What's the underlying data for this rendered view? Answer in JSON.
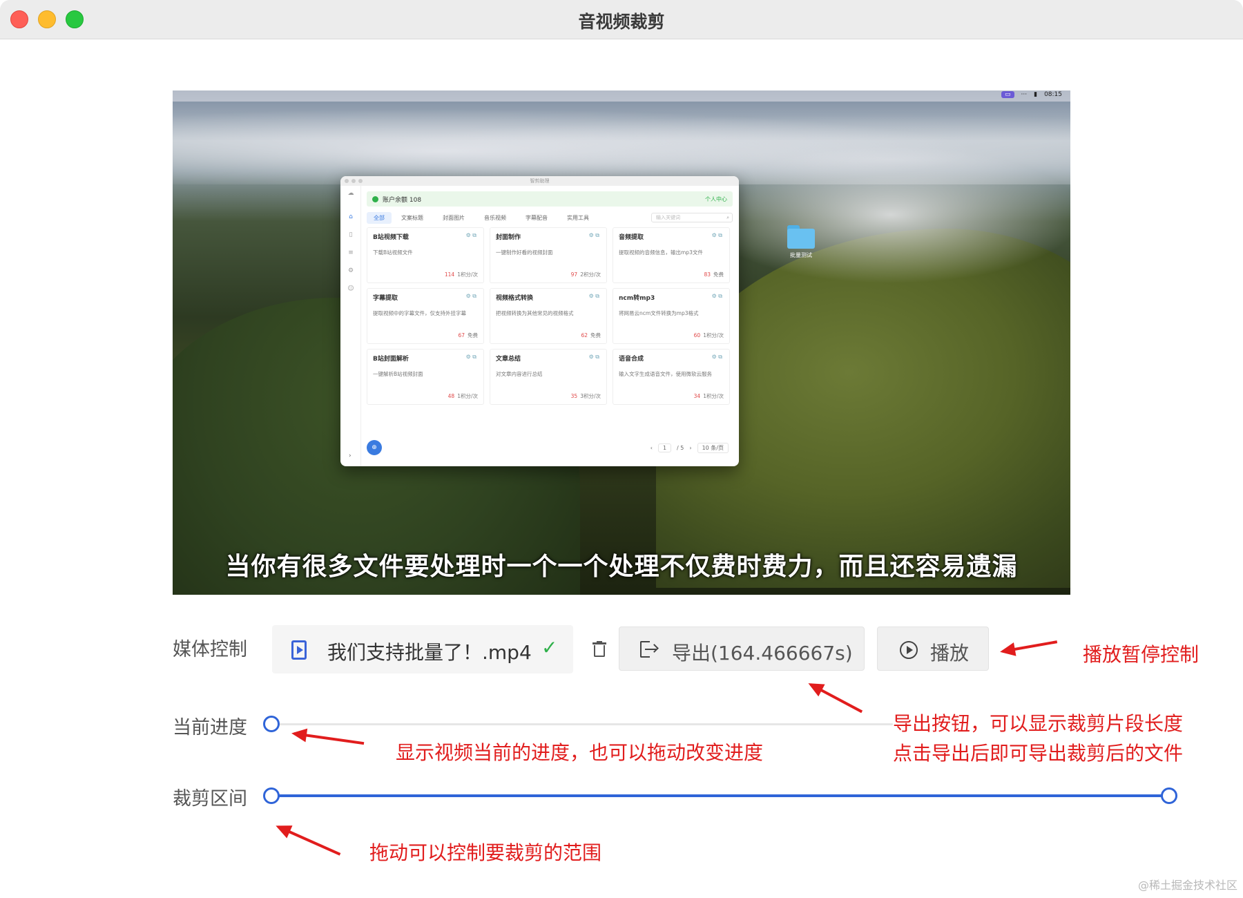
{
  "window": {
    "title": "音视频裁剪"
  },
  "video": {
    "subtitle": "当你有很多文件要处理时一个一个处理不仅费时费力，而且还容易遗漏",
    "menubar": {
      "clock": "08:15"
    },
    "desktop_folder": "批量测试",
    "inner_app": {
      "title": "智剪助理",
      "balance": "账户余额 108",
      "profile": "个人中心",
      "tabs": [
        "全部",
        "文案标题",
        "封面图片",
        "音乐视频",
        "字幕配音",
        "实用工具"
      ],
      "search_placeholder": "输入关键词",
      "cards": [
        {
          "title": "B站视频下载",
          "desc": "下载B站视频文件",
          "hot": "114",
          "cost": "1积分/次"
        },
        {
          "title": "封面制作",
          "desc": "一键制作好看的视频封面",
          "hot": "97",
          "cost": "2积分/次"
        },
        {
          "title": "音频提取",
          "desc": "提取视频的音频信息，输出mp3文件",
          "hot": "83",
          "cost": "免费"
        },
        {
          "title": "字幕提取",
          "desc": "提取视频中的字幕文件，仅支持外挂字幕",
          "hot": "67",
          "cost": "免费"
        },
        {
          "title": "视频格式转换",
          "desc": "把视频转换为其他常见的视频格式",
          "hot": "62",
          "cost": "免费"
        },
        {
          "title": "ncm转mp3",
          "desc": "将网易云ncm文件转换为mp3格式",
          "hot": "60",
          "cost": "1积分/次"
        },
        {
          "title": "B站封面解析",
          "desc": "一键解析B站视频封面",
          "hot": "48",
          "cost": "1积分/次"
        },
        {
          "title": "文章总结",
          "desc": "对文章内容进行总结",
          "hot": "35",
          "cost": "3积分/次"
        },
        {
          "title": "语音合成",
          "desc": "输入文字生成语音文件，使用微软云服务",
          "hot": "34",
          "cost": "1积分/次"
        }
      ],
      "pager": {
        "page": "1",
        "total": "/ 5",
        "per_page": "10 条/页"
      }
    }
  },
  "controls": {
    "media_label": "媒体控制",
    "file_name": "我们支持批量了！.mp4",
    "export_label": "导出(164.466667s)",
    "play_label": "播放",
    "progress_label": "当前进度",
    "range_label": "裁剪区间",
    "progress_value": 0.0,
    "range": {
      "start": 0.0,
      "end": 1.0
    }
  },
  "annotations": {
    "play": "播放暂停控制",
    "export_line1": "导出按钮，可以显示裁剪片段长度",
    "export_line2": "点击导出后即可导出裁剪后的文件",
    "progress": "显示视频当前的进度，也可以拖动改变进度",
    "range": "拖动可以控制要裁剪的范围"
  },
  "watermark": "@稀土掘金技术社区",
  "colors": {
    "accent": "#2f64d8",
    "annotation": "#e11d1d",
    "success": "#2fb04a"
  }
}
